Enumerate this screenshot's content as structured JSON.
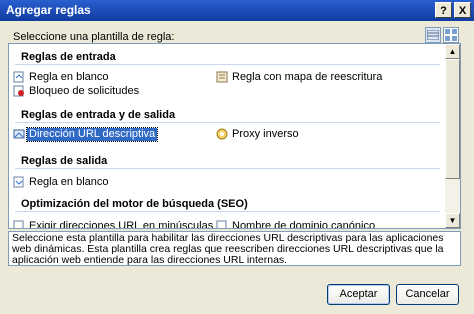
{
  "dialog": {
    "title": "Agregar reglas"
  },
  "prompt": "Seleccione una plantilla de regla:",
  "groups": [
    {
      "header": "Reglas de entrada",
      "items": [
        "Regla en blanco",
        "Regla con mapa de reescritura",
        "Bloqueo de solicitudes"
      ]
    },
    {
      "header": "Reglas de entrada y de salida",
      "items": [
        "Dirección URL descriptiva",
        "Proxy inverso"
      ],
      "selected": "Dirección URL descriptiva"
    },
    {
      "header": "Reglas de salida",
      "items": [
        "Regla en blanco"
      ]
    },
    {
      "header": "Optimización del motor de búsqueda (SEO)",
      "items": [
        "Exigir direcciones URL en minúsculas",
        "Nombre de dominio canónico"
      ]
    }
  ],
  "description": "Seleccione esta plantilla para habilitar las direcciones URL descriptivas para las aplicaciones web dinámicas. Esta plantilla crea reglas que reescriben direcciones URL descriptivas que la aplicación web entiende para las direcciones URL internas.",
  "buttons": {
    "ok": "Aceptar",
    "cancel": "Cancelar"
  },
  "titlebar_buttons": {
    "help": "?",
    "close": "X"
  },
  "colors": {
    "title_bar": "#0f3c9e",
    "selection": "#316ac5",
    "dialog_bg": "#ece9d8"
  }
}
